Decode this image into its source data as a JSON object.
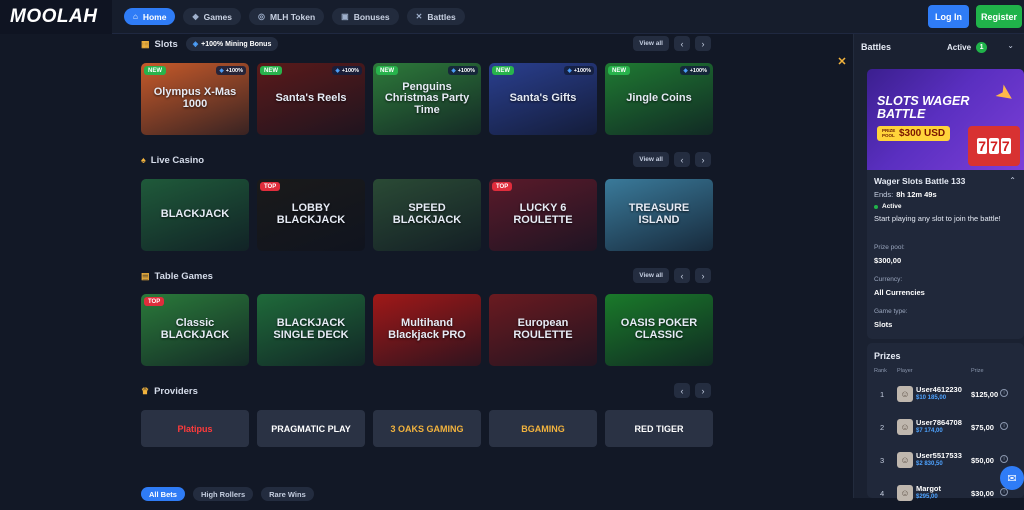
{
  "brand": {
    "logo_text": "MOOLAH"
  },
  "nav": [
    {
      "label": "Home",
      "icon": "home-icon",
      "glyph": "⌂",
      "active": true
    },
    {
      "label": "Games",
      "icon": "games-icon",
      "glyph": "◆",
      "active": false
    },
    {
      "label": "MLH Token",
      "icon": "token-icon",
      "glyph": "◎",
      "active": false
    },
    {
      "label": "Bonuses",
      "icon": "gift-icon",
      "glyph": "▣",
      "active": false
    },
    {
      "label": "Battles",
      "icon": "swords-icon",
      "glyph": "✕",
      "active": false
    }
  ],
  "auth": {
    "login_label": "Log In",
    "register_label": "Register"
  },
  "sections": {
    "slots": {
      "title": "Slots",
      "bonus_label": "+100% Mining Bonus",
      "view_all": "View all"
    },
    "live": {
      "title": "Live Casino",
      "view_all": "View all"
    },
    "table": {
      "title": "Table Games",
      "view_all": "View all"
    },
    "providers": {
      "title": "Providers"
    }
  },
  "arrows": {
    "prev": "‹",
    "next": "›"
  },
  "slots_games": [
    {
      "name": "Olympus X-Mas 1000",
      "badge": "NEW",
      "mining": "+100%",
      "bg": "#c75a2a"
    },
    {
      "name": "Santa's Reels",
      "badge": "NEW",
      "mining": "+100%",
      "bg": "#5a1a1a"
    },
    {
      "name": "Penguins Christmas Party Time",
      "badge": "NEW",
      "mining": "+100%",
      "bg": "#2d7a3a"
    },
    {
      "name": "Santa's Gifts",
      "badge": "NEW",
      "mining": "+100%",
      "bg": "#2a3f8f"
    },
    {
      "name": "Jingle Coins",
      "badge": "NEW",
      "mining": "+100%",
      "bg": "#1f7a32"
    }
  ],
  "live_games": [
    {
      "name": "BLACKJACK",
      "badge": "",
      "bg": "#1f5a3a"
    },
    {
      "name": "LOBBY BLACKJACK",
      "badge": "TOP",
      "bg": "#1a1a1a"
    },
    {
      "name": "SPEED BLACKJACK",
      "badge": "",
      "bg": "#2a4a35"
    },
    {
      "name": "LUCKY 6 ROULETTE",
      "badge": "TOP",
      "bg": "#5a1a2a"
    },
    {
      "name": "TREASURE ISLAND",
      "badge": "",
      "bg": "#3a7a9a"
    }
  ],
  "table_games": [
    {
      "name": "Classic BLACKJACK",
      "badge": "TOP",
      "bg": "#2a7a3a"
    },
    {
      "name": "BLACKJACK SINGLE DECK",
      "badge": "",
      "bg": "#1f6a3a"
    },
    {
      "name": "Multihand Blackjack PRO",
      "badge": "",
      "bg": "#a01818"
    },
    {
      "name": "European ROULETTE",
      "badge": "",
      "bg": "#6a1a20"
    },
    {
      "name": "OASIS POKER CLASSIC",
      "badge": "",
      "bg": "#1a7a2a"
    }
  ],
  "providers": [
    {
      "name": "Platipus",
      "color": "#ff3b3b"
    },
    {
      "name": "PRAGMATIC PLAY",
      "color": "#ffffff"
    },
    {
      "name": "3 OAKS GAMING",
      "color": "#f2b33d"
    },
    {
      "name": "BGAMING",
      "color": "#f2b33d"
    },
    {
      "name": "RED TIGER",
      "color": "#ffffff"
    }
  ],
  "bets_tabs": [
    {
      "label": "All Bets",
      "active": true
    },
    {
      "label": "High Rollers",
      "active": false
    },
    {
      "label": "Rare Wins",
      "active": false
    }
  ],
  "panel": {
    "title": "Battles",
    "active_label": "Active",
    "active_count": "1",
    "banner_title_line1": "SLOTS WAGER",
    "banner_title_line2": "BATTLE",
    "prize_pool_small": "PRIZE POOL",
    "prize_pool_big": "$300 USD",
    "battle_name": "Wager Slots Battle 133",
    "ends_label": "Ends:",
    "ends_value": "8h 12m 49s",
    "status": "Active",
    "description": "Start playing any slot to join the battle!",
    "prize_pool_label": "Prize pool:",
    "prize_pool_value": "$300,00",
    "currency_label": "Currency:",
    "currency_value": "All Currencies",
    "game_type_label": "Game type:",
    "game_type_value": "Slots"
  },
  "prizes": {
    "title": "Prizes",
    "col_rank": "Rank",
    "col_player": "Player",
    "col_prize": "Prize",
    "rows": [
      {
        "rank": "1",
        "user": "User4612230",
        "wager": "$10 185,00",
        "prize": "$125,00"
      },
      {
        "rank": "2",
        "user": "User7864708",
        "wager": "$7 174,00",
        "prize": "$75,00"
      },
      {
        "rank": "3",
        "user": "User5517533",
        "wager": "$2 830,50",
        "prize": "$50,00"
      },
      {
        "rank": "4",
        "user": "Margot",
        "wager": "$295,00",
        "prize": "$30,00"
      }
    ]
  },
  "colors": {
    "accent": "#2f7cf6",
    "success": "#20b34a",
    "bg": "#121826",
    "panel": "#1a2131"
  }
}
